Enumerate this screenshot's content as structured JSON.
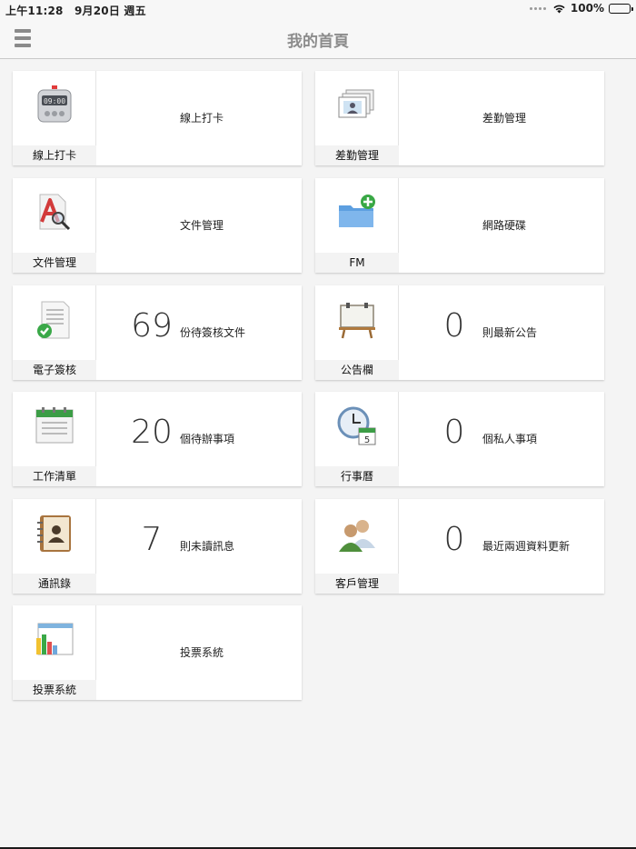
{
  "status": {
    "time": "上午11:28",
    "date": "9月20日 週五",
    "battery": "100%"
  },
  "navbar": {
    "title": "我的首頁"
  },
  "tiles": [
    {
      "caption": "線上打卡",
      "count": "",
      "desc": "線上打卡",
      "icon": "timer-icon"
    },
    {
      "caption": "差勤管理",
      "count": "",
      "desc": "差勤管理",
      "icon": "id-cards-icon"
    },
    {
      "caption": "文件管理",
      "count": "",
      "desc": "文件管理",
      "icon": "document-search-icon"
    },
    {
      "caption": "FM",
      "count": "",
      "desc": "網路硬碟",
      "icon": "folder-add-icon"
    },
    {
      "caption": "電子簽核",
      "count": "69",
      "desc": "份待簽核文件",
      "icon": "signed-document-icon"
    },
    {
      "caption": "公告欄",
      "count": "0",
      "desc": "則最新公告",
      "icon": "bulletin-board-icon"
    },
    {
      "caption": "工作清單",
      "count": "20",
      "desc": "個待辦事項",
      "icon": "task-list-icon"
    },
    {
      "caption": "行事曆",
      "count": "0",
      "desc": "個私人事項",
      "icon": "calendar-clock-icon"
    },
    {
      "caption": "通訊錄",
      "count": "7",
      "desc": "則未讀訊息",
      "icon": "address-book-icon"
    },
    {
      "caption": "客戶管理",
      "count": "0",
      "desc": "最近兩週資料更新",
      "icon": "customers-icon"
    },
    {
      "caption": "投票系統",
      "count": "",
      "desc": "投票系統",
      "icon": "vote-chart-icon"
    }
  ]
}
